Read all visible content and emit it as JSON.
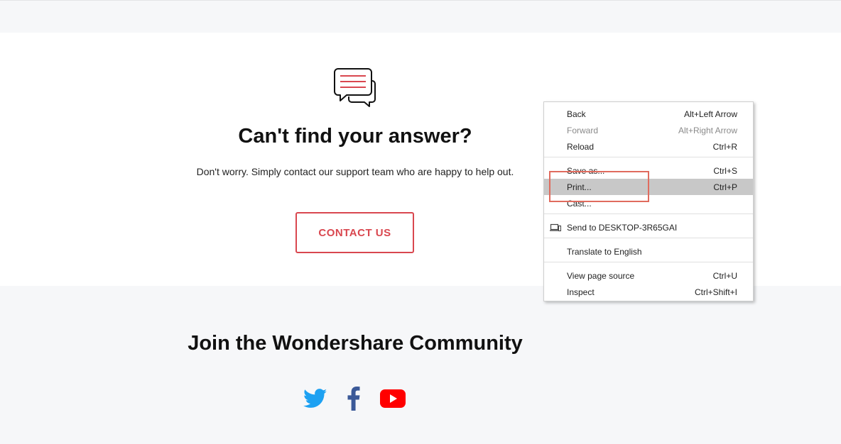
{
  "help": {
    "title": "Can't find your answer?",
    "description": "Don't worry. Simply contact our support team who are happy to help out.",
    "contact_button": "CONTACT US"
  },
  "community": {
    "title": "Join the Wondershare Community",
    "social_icons": [
      "twitter-icon",
      "facebook-icon",
      "youtube-icon"
    ]
  },
  "context_menu": {
    "items": [
      {
        "label": "Back",
        "shortcut": "Alt+Left Arrow",
        "disabled": false
      },
      {
        "label": "Forward",
        "shortcut": "Alt+Right Arrow",
        "disabled": true
      },
      {
        "label": "Reload",
        "shortcut": "Ctrl+R",
        "disabled": false
      },
      {
        "label": "Save as...",
        "shortcut": "Ctrl+S",
        "disabled": false
      },
      {
        "label": "Print...",
        "shortcut": "Ctrl+P",
        "disabled": false,
        "highlighted": true
      },
      {
        "label": "Cast...",
        "shortcut": "",
        "disabled": false
      },
      {
        "label": "Send to DESKTOP-3R65GAI",
        "shortcut": "",
        "disabled": false
      },
      {
        "label": "Translate to English",
        "shortcut": "",
        "disabled": false
      },
      {
        "label": "View page source",
        "shortcut": "Ctrl+U",
        "disabled": false
      },
      {
        "label": "Inspect",
        "shortcut": "Ctrl+Shift+I",
        "disabled": false
      }
    ]
  },
  "colors": {
    "accent": "#d9474f",
    "highlight_box": "#e06b5e",
    "twitter": "#1da1f2",
    "facebook": "#3b5998",
    "youtube": "#ff0000"
  }
}
